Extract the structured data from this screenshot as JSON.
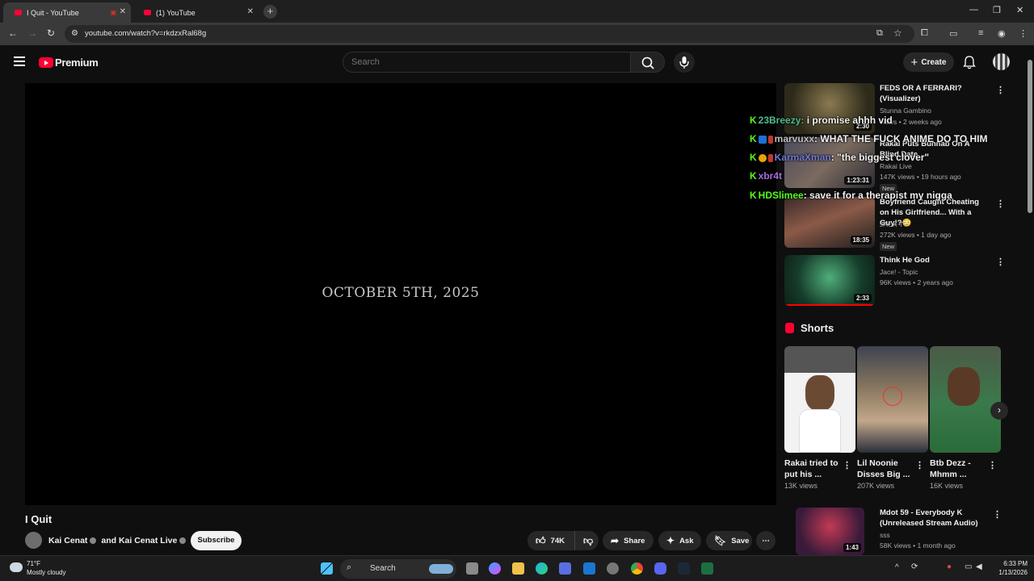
{
  "browser": {
    "tabs": [
      {
        "title": "I Quit - YouTube",
        "active": true
      },
      {
        "title": "(1) YouTube",
        "active": false
      }
    ],
    "url": "youtube.com/watch?v=rkdzxRal68g"
  },
  "header": {
    "logo_text": "Premium",
    "search_placeholder": "Search",
    "create_label": "Create"
  },
  "video": {
    "overlay_text": "OCTOBER 5TH, 2025",
    "title": "I Quit",
    "channel": "Kai Cenat",
    "channel_and": "and",
    "channel2": "Kai Cenat Live",
    "subscribe_label": "Subscribe",
    "likes": "74K",
    "share_label": "Share",
    "ask_label": "Ask",
    "save_label": "Save"
  },
  "chat": [
    {
      "user": "23Breezy",
      "message": "i promise ahhh vid",
      "user_color": "#4dbf8f"
    },
    {
      "user": "marvuxx",
      "message": "WHAT THE FUCK ANIME DO TO HIM",
      "user_color": "#bfbfbf"
    },
    {
      "user": "KarmaXman",
      "message": "\"the biggest clover\"",
      "user_color": "#6f7bd6"
    },
    {
      "user": "xbr4t",
      "message": "",
      "user_color": "#a66bdf"
    },
    {
      "user": "HDSlimee",
      "message": "save it for a therapist my nigga",
      "user_color": "#53fc18"
    }
  ],
  "recommendations": [
    {
      "title": "FEDS OR A FERRARI? (Visualizer)",
      "channel": "Stunna Gambino",
      "meta": "views • 2 weeks ago",
      "duration": "2:30",
      "is_new": false
    },
    {
      "title": "Rakai Puts Bunnab On A Blind Date",
      "channel": "Rakai Live",
      "meta": "147K views • 19 hours ago",
      "duration": "1:23:31",
      "is_new": true
    },
    {
      "title": "Boyfriend Caught Cheating on His Girlfriend... With a Guy!?😳",
      "channel": "JACK TV",
      "meta": "272K views • 1 day ago",
      "duration": "18:35",
      "is_new": true
    },
    {
      "title": "Think He God",
      "channel": "Jace! - Topic",
      "meta": "96K views • 2 years ago",
      "duration": "2:33",
      "is_new": false
    },
    {
      "title": "Mdot 59 - Everybody K (Unreleased Stream Audio)",
      "channel": "sss",
      "meta": "58K views • 1 month ago",
      "duration": "1:43",
      "is_new": false
    }
  ],
  "new_badge": "New",
  "shorts": {
    "heading": "Shorts",
    "items": [
      {
        "title": "Rakai tried to put his ...",
        "views": "13K views"
      },
      {
        "title": "Lil Noonie Disses Big ...",
        "views": "207K views"
      },
      {
        "title": "Btb Dezz - Mhmm ...",
        "views": "16K views"
      }
    ]
  },
  "taskbar": {
    "temp": "71°F",
    "weather": "Mostly cloudy",
    "search_label": "Search",
    "time": "6:33 PM",
    "date": "1/13/2026"
  }
}
